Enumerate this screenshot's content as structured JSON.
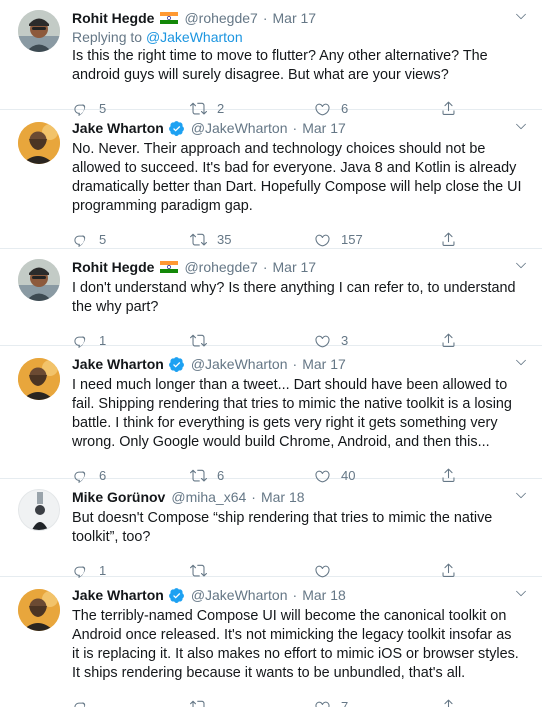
{
  "tweets": [
    {
      "name": "Rohit Hegde",
      "flag": "india-flag",
      "handle": "@rohegde7",
      "date": "Mar 17",
      "reply_prefix": "Replying to ",
      "reply_to": "@JakeWharton",
      "text": "Is this the right time to move to flutter? Any other alternative? The android guys will surely disagree. But what are your views?",
      "replies": "5",
      "retweets": "2",
      "likes": "6"
    },
    {
      "name": "Jake Wharton",
      "verified": true,
      "handle": "@JakeWharton",
      "date": "Mar 17",
      "text": "No. Never. Their approach and technology choices should not be allowed to succeed. It's bad for everyone. Java 8 and Kotlin is already dramatically better than Dart. Hopefully Compose will help close the UI programming paradigm gap.",
      "replies": "5",
      "retweets": "35",
      "likes": "157"
    },
    {
      "name": "Rohit Hegde",
      "flag": "india-flag",
      "handle": "@rohegde7",
      "date": "Mar 17",
      "text": "I don't understand why? Is there anything I can refer to, to understand the why part?",
      "replies": "1",
      "retweets": "",
      "likes": "3"
    },
    {
      "name": "Jake Wharton",
      "verified": true,
      "handle": "@JakeWharton",
      "date": "Mar 17",
      "text": "I need much longer than a tweet... Dart should have been allowed to fail. Shipping rendering that tries to mimic the native toolkit is a losing battle. I think for everything is gets very right it gets something very wrong. Only Google would build Chrome, Android, and then this...",
      "replies": "6",
      "retweets": "6",
      "likes": "40"
    },
    {
      "name": "Mike Gorünov",
      "handle": "@miha_x64",
      "date": "Mar 18",
      "text": "But doesn't Compose “ship rendering that tries to mimic the native toolkit”, too?",
      "replies": "1",
      "retweets": "",
      "likes": ""
    },
    {
      "name": "Jake Wharton",
      "verified": true,
      "handle": "@JakeWharton",
      "date": "Mar 18",
      "text": "The terribly-named Compose UI will become the canonical toolkit on Android once released. It's not mimicking the legacy toolkit insofar as it is replacing it. It also makes no effort to mimic iOS or browser styles. It ships rendering because it wants to be unbundled, that's all.",
      "replies": "",
      "retweets": "",
      "likes": "7"
    }
  ],
  "dot": "·",
  "colors": {
    "text": "#14171a",
    "secondary": "#657786",
    "link": "#1b95e0",
    "verified": "#1da1f2",
    "divider": "#e6ecf0"
  },
  "icons": [
    "reply-icon",
    "retweet-icon",
    "like-icon",
    "share-icon",
    "chevron-down-icon",
    "verified-badge-icon"
  ]
}
